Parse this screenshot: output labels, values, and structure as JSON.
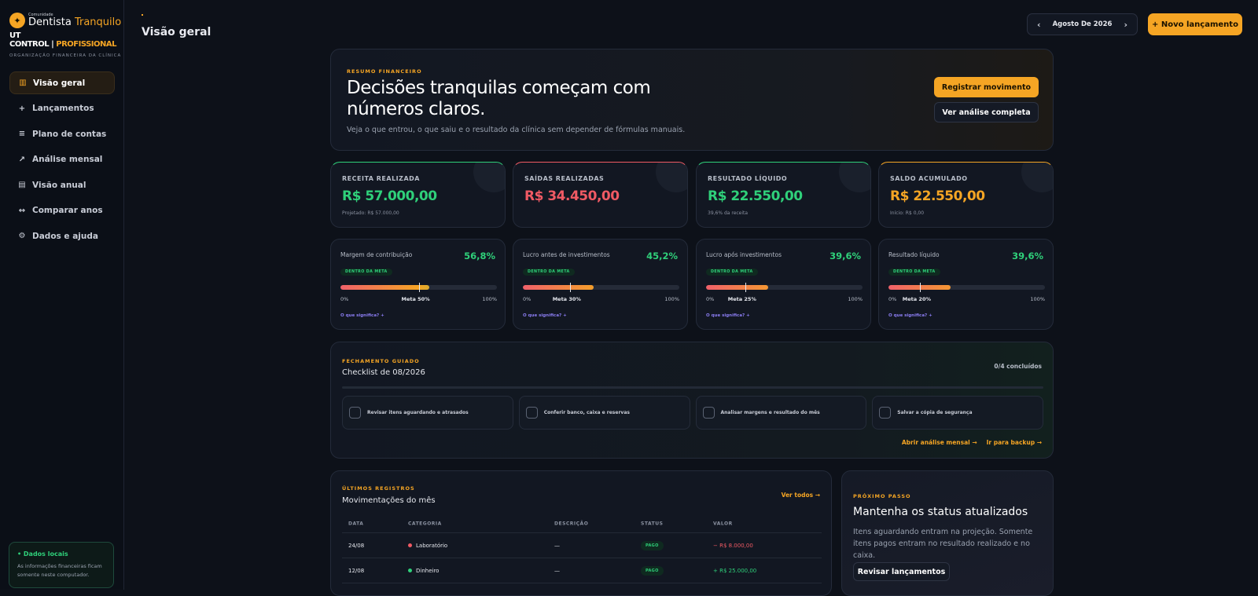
{
  "brand": {
    "small": "Comunidade",
    "name_a": "Dentista",
    "name_b": "Tranquilo",
    "ut": "UT CONTROL",
    "sep": "|",
    "pro": "PROFISSIONAL",
    "tagline": "ORGANIZAÇÃO FINANCEIRA DA CLÍNICA"
  },
  "sidebar": {
    "items": [
      {
        "label": "Visão geral",
        "icon": "▥"
      },
      {
        "label": "Lançamentos",
        "icon": "+"
      },
      {
        "label": "Plano de contas",
        "icon": "≡"
      },
      {
        "label": "Análise mensal",
        "icon": "↗"
      },
      {
        "label": "Visão anual",
        "icon": "▤"
      },
      {
        "label": "Comparar anos",
        "icon": "↔"
      },
      {
        "label": "Dados e ajuda",
        "icon": "⚙"
      }
    ],
    "local_title": "• Dados locais",
    "local_text": "As informações financeiras ficam somente neste computador."
  },
  "header": {
    "title": "Visão geral",
    "month": "Agosto De 2026",
    "prev": "‹",
    "next": "›",
    "new_button": "+ Novo lançamento"
  },
  "hero": {
    "eyebrow": "RESUMO FINANCEIRO",
    "title": "Decisões tranquilas começam com números claros.",
    "subtitle": "Veja o que entrou, o que saiu e o resultado da clínica sem depender de fórmulas manuais.",
    "primary": "Registrar movimento",
    "secondary": "Ver análise completa"
  },
  "kpis": [
    {
      "label": "RECEITA REALIZADA",
      "value": "R$ 57.000,00",
      "note": "Projetado: R$ 57.000,00",
      "color": "#2fd07a"
    },
    {
      "label": "SAÍDAS REALIZADAS",
      "value": "R$ 34.450,00",
      "note": "",
      "color": "#f05a64"
    },
    {
      "label": "RESULTADO LÍQUIDO",
      "value": "R$ 22.550,00",
      "note": "39,6% da receita",
      "color": "#2fd07a"
    },
    {
      "label": "SALDO ACUMULADO",
      "value": "R$ 22.550,00",
      "note": "Início: R$ 0,00",
      "color": "#f5a524"
    }
  ],
  "metrics": [
    {
      "label": "Margem de contribuição",
      "pct": "56,8%",
      "value": 56.8,
      "goal": 50,
      "badge": "DENTRO DA META",
      "lo": "0%",
      "goal_label": "Meta 50%",
      "hi": "100%",
      "link": "O que significa? +"
    },
    {
      "label": "Lucro antes de investimentos",
      "pct": "45,2%",
      "value": 45.2,
      "goal": 30,
      "badge": "DENTRO DA META",
      "lo": "0%",
      "goal_label": "Meta 30%",
      "hi": "100%",
      "link": "O que significa? +"
    },
    {
      "label": "Lucro após investimentos",
      "pct": "39,6%",
      "value": 39.6,
      "goal": 25,
      "badge": "DENTRO DA META",
      "lo": "0%",
      "goal_label": "Meta 25%",
      "hi": "100%",
      "link": "O que significa? +"
    },
    {
      "label": "Resultado líquido",
      "pct": "39,6%",
      "value": 39.6,
      "goal": 20,
      "badge": "DENTRO DA META",
      "lo": "0%",
      "goal_label": "Meta 20%",
      "hi": "100%",
      "link": "O que significa? +"
    }
  ],
  "checklist": {
    "eyebrow": "FECHAMENTO GUIADO",
    "title": "Checklist de 08/2026",
    "count": "0/4 concluídos",
    "items": [
      "Revisar itens aguardando e atrasados",
      "Conferir banco, caixa e reservas",
      "Analisar margens e resultado do mês",
      "Salvar a cópia de segurança"
    ],
    "link1": "Abrir análise mensal →",
    "link2": "Ir para backup →"
  },
  "records": {
    "eyebrow": "ÚLTIMOS REGISTROS",
    "title": "Movimentações do mês",
    "see_all": "Ver todos →",
    "columns": [
      "DATA",
      "CATEGORIA",
      "DESCRIÇÃO",
      "STATUS",
      "VALOR"
    ],
    "rows": [
      {
        "date": "24/08",
        "category": "Laboratório",
        "dot": "#f05a64",
        "desc": "—",
        "status": "PAGO",
        "value": "− R$ 8.000,00",
        "kind": "neg"
      },
      {
        "date": "12/08",
        "category": "Dinheiro",
        "dot": "#2fd07a",
        "desc": "—",
        "status": "PAGO",
        "value": "+ R$ 25.000,00",
        "kind": "pos"
      }
    ]
  },
  "next_step": {
    "eyebrow": "PRÓXIMO PASSO",
    "title": "Mantenha os status atualizados",
    "text": "Itens aguardando entram na projeção. Somente itens pagos entram no resultado realizado e no caixa.",
    "button": "Revisar lançamentos"
  }
}
